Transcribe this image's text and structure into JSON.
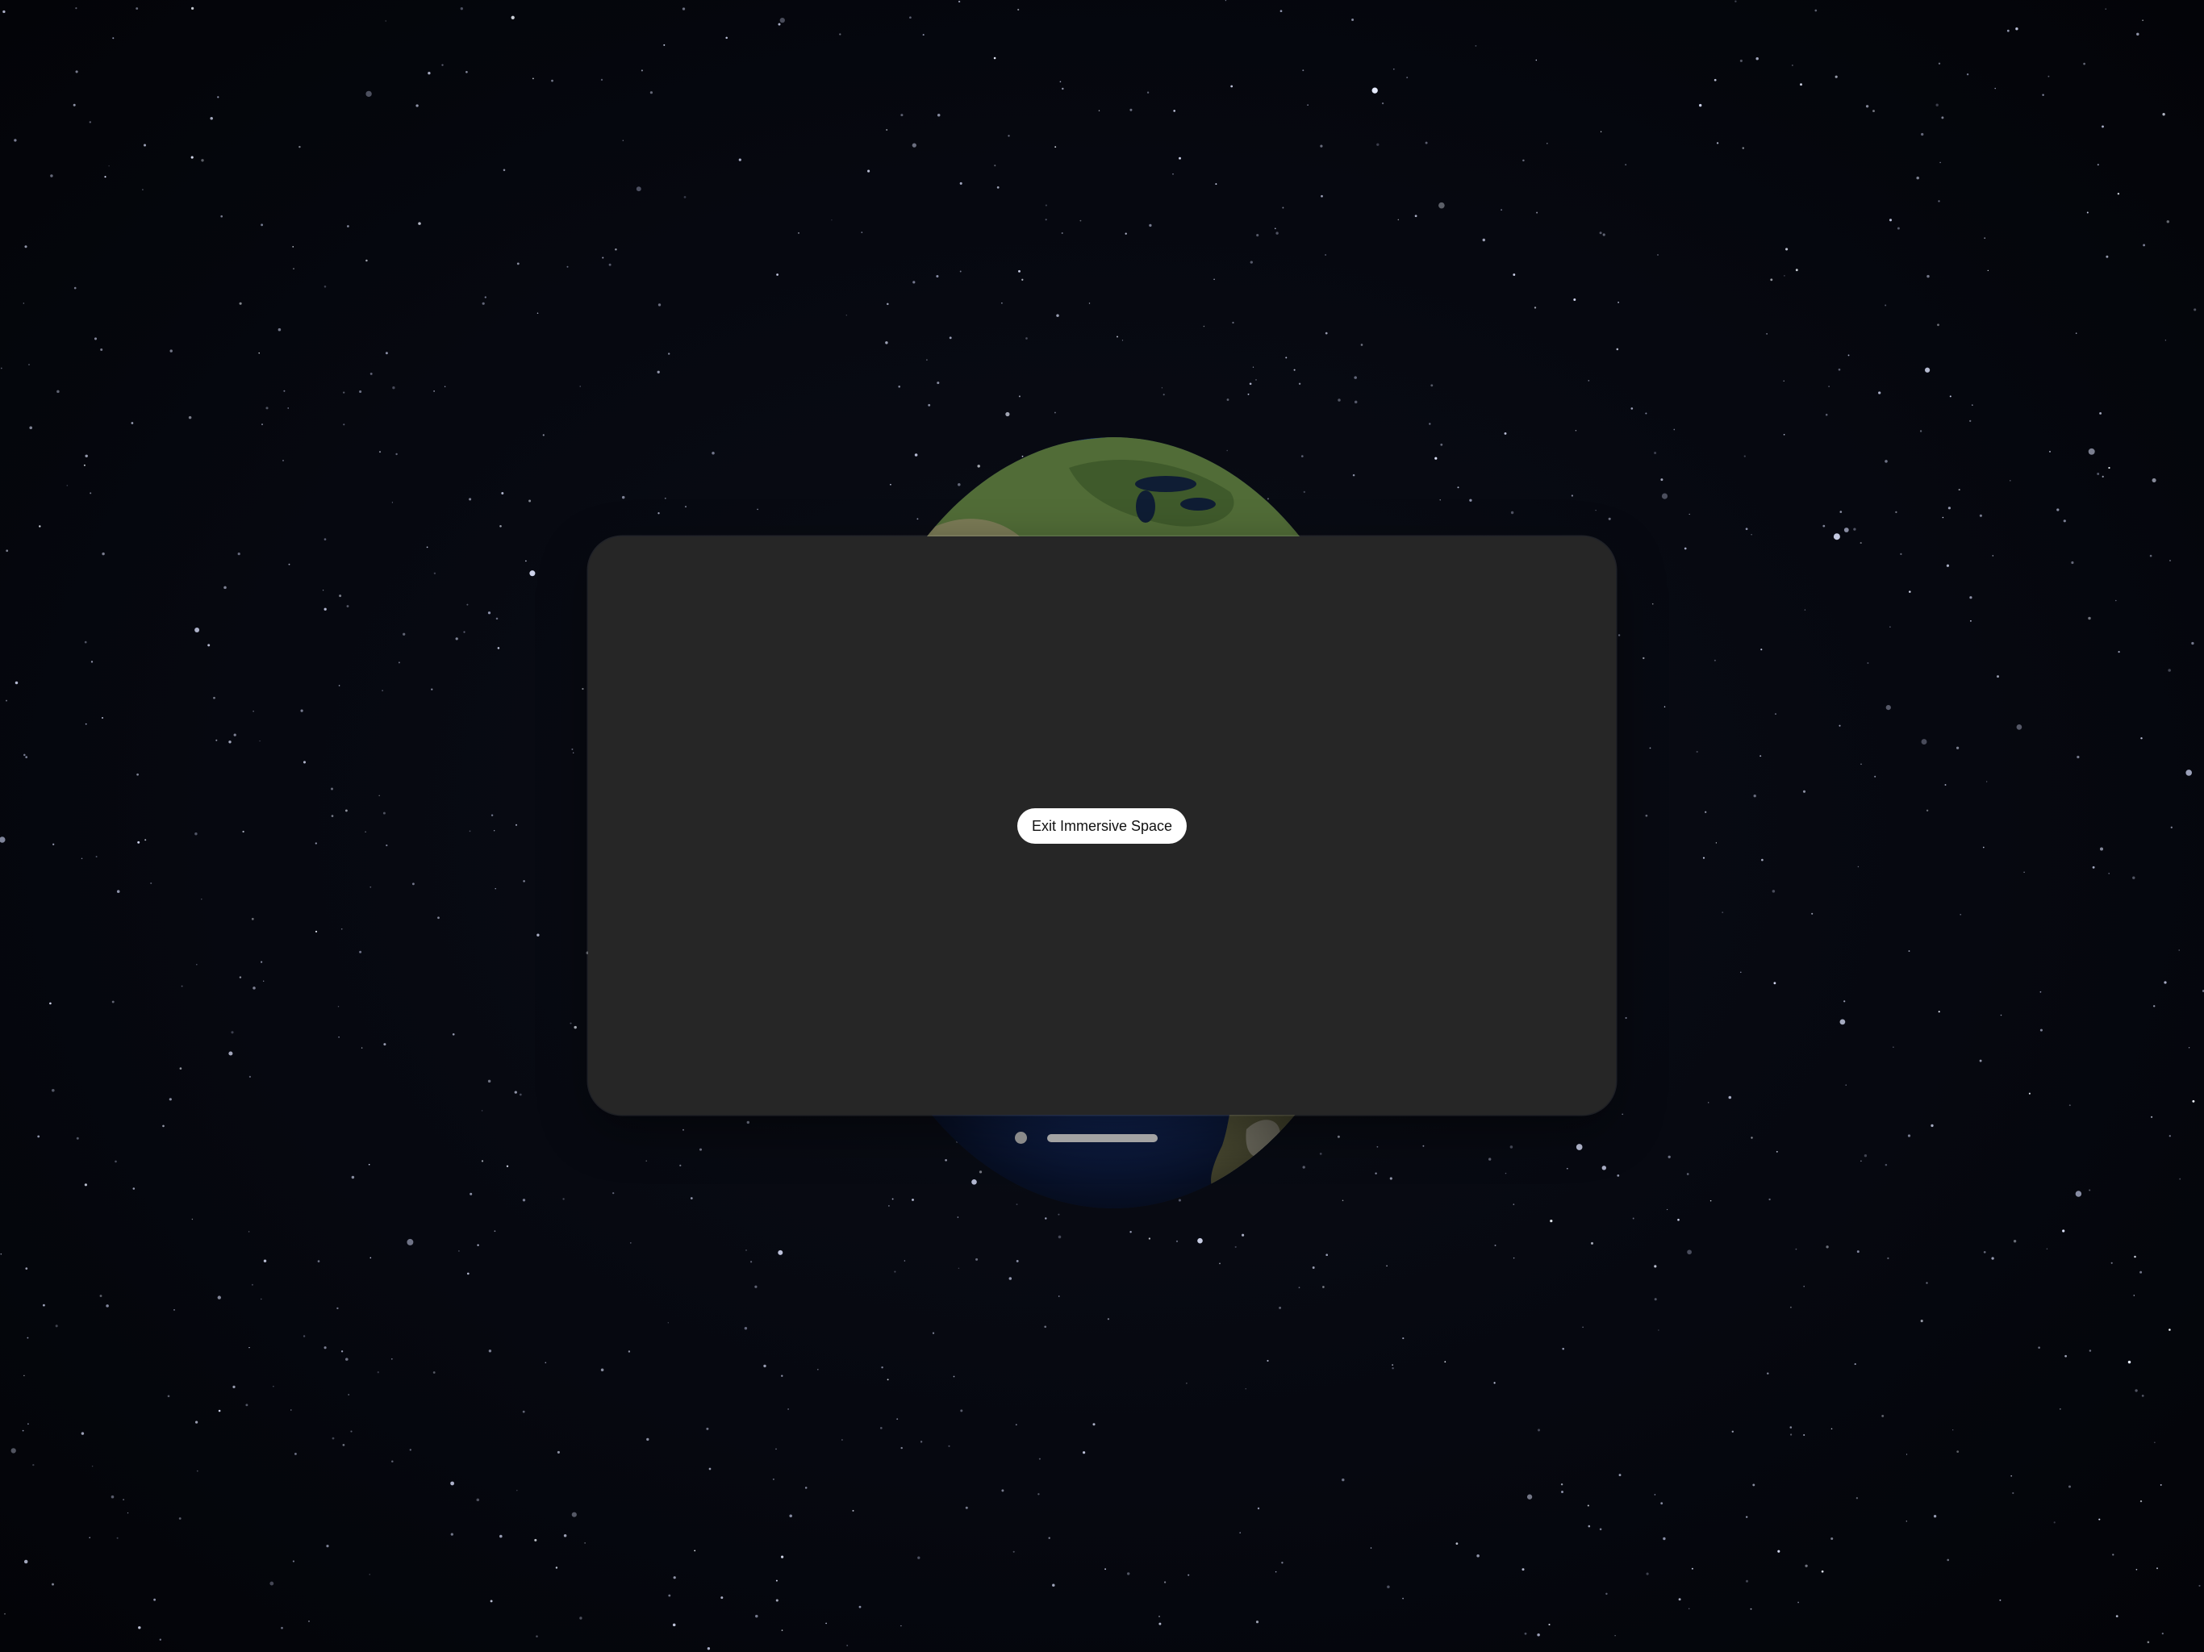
{
  "scene": {
    "background_color": "#05070c",
    "earth_ocean_color": "#1b3a80",
    "earth_land_color": "#4f6a35"
  },
  "window": {
    "background_color": "#262626",
    "exit_button": {
      "label": "Exit Immersive Space",
      "background_color": "#ffffff",
      "text_color": "#111111"
    }
  },
  "window_controls": {
    "close_icon": "close-dot-icon",
    "grab_bar": "window-grab-bar"
  }
}
